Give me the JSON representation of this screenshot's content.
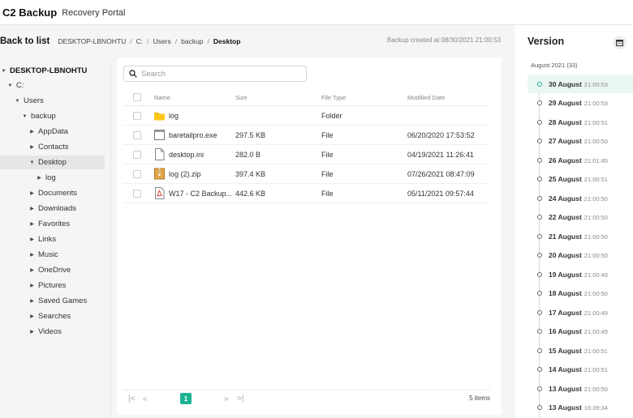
{
  "app": {
    "name": "C2 Backup",
    "subtitle": "Recovery Portal"
  },
  "breadcrumb": {
    "back_label": "Back to list",
    "items": [
      "DESKTOP-LBNOHTU",
      "C:",
      "Users",
      "backup",
      "Desktop"
    ],
    "created": "Backup created at 08/30/2021 21:00:53"
  },
  "tree": [
    {
      "label": "DESKTOP-LBNOHTU",
      "expanded": true
    },
    {
      "label": "C:",
      "expanded": true
    },
    {
      "label": "Users",
      "expanded": true
    },
    {
      "label": "backup",
      "expanded": true
    },
    {
      "label": "AppData",
      "expanded": false
    },
    {
      "label": "Contacts",
      "expanded": false
    },
    {
      "label": "Desktop",
      "expanded": true,
      "selected": true
    },
    {
      "label": "log",
      "expanded": false
    },
    {
      "label": "Documents",
      "expanded": false
    },
    {
      "label": "Downloads",
      "expanded": false
    },
    {
      "label": "Favorites",
      "expanded": false
    },
    {
      "label": "Links",
      "expanded": false
    },
    {
      "label": "Music",
      "expanded": false
    },
    {
      "label": "OneDrive",
      "expanded": false
    },
    {
      "label": "Pictures",
      "expanded": false
    },
    {
      "label": "Saved Games",
      "expanded": false
    },
    {
      "label": "Searches",
      "expanded": false
    },
    {
      "label": "Videos",
      "expanded": false
    }
  ],
  "search": {
    "placeholder": "Search"
  },
  "table": {
    "columns": [
      "Name",
      "Size",
      "File Type",
      "Modified Date"
    ],
    "rows": [
      {
        "icon": "folder-icon",
        "name": "log",
        "size": "",
        "type": "Folder",
        "modified": ""
      },
      {
        "icon": "exe-file-icon",
        "name": "baretailpro.exe",
        "size": "297.5 KB",
        "type": "File",
        "modified": "06/20/2020 17:53:52"
      },
      {
        "icon": "file-icon",
        "name": "desktop.ini",
        "size": "282.0 B",
        "type": "File",
        "modified": "04/19/2021 11:26:41"
      },
      {
        "icon": "zip-file-icon",
        "name": "log (2).zip",
        "size": "397.4 KB",
        "type": "File",
        "modified": "07/26/2021 08:47:09"
      },
      {
        "icon": "pdf-file-icon",
        "name": "W17 - C2 Backup...",
        "size": "442.6 KB",
        "type": "File",
        "modified": "05/11/2021 09:57:44"
      }
    ]
  },
  "pagination": {
    "first": "|<",
    "prev": "«",
    "current": "1",
    "next": "»",
    "last": ">|",
    "count_label": "5 items"
  },
  "versions": {
    "title": "Version",
    "group_label": "August 2021 (33)",
    "items": [
      {
        "date": "30 August",
        "time": "21:00:53",
        "active": true
      },
      {
        "date": "29 August",
        "time": "21:00:53"
      },
      {
        "date": "28 August",
        "time": "21:00:51"
      },
      {
        "date": "27 August",
        "time": "21:00:50"
      },
      {
        "date": "26 August",
        "time": "21:01:45"
      },
      {
        "date": "25 August",
        "time": "21:00:51"
      },
      {
        "date": "24 August",
        "time": "21:00:50"
      },
      {
        "date": "22 August",
        "time": "21:00:50"
      },
      {
        "date": "21 August",
        "time": "21:00:50"
      },
      {
        "date": "20 August",
        "time": "21:00:50"
      },
      {
        "date": "19 August",
        "time": "21:00:49"
      },
      {
        "date": "18 August",
        "time": "21:00:50"
      },
      {
        "date": "17 August",
        "time": "21:00:49"
      },
      {
        "date": "16 August",
        "time": "21:00:49"
      },
      {
        "date": "15 August",
        "time": "21:00:51"
      },
      {
        "date": "14 August",
        "time": "21:00:51"
      },
      {
        "date": "13 August",
        "time": "21:00:50"
      },
      {
        "date": "13 August",
        "time": "16:39:34"
      }
    ]
  },
  "colors": {
    "accent": "#1ab394",
    "folder": "#f5b800"
  }
}
